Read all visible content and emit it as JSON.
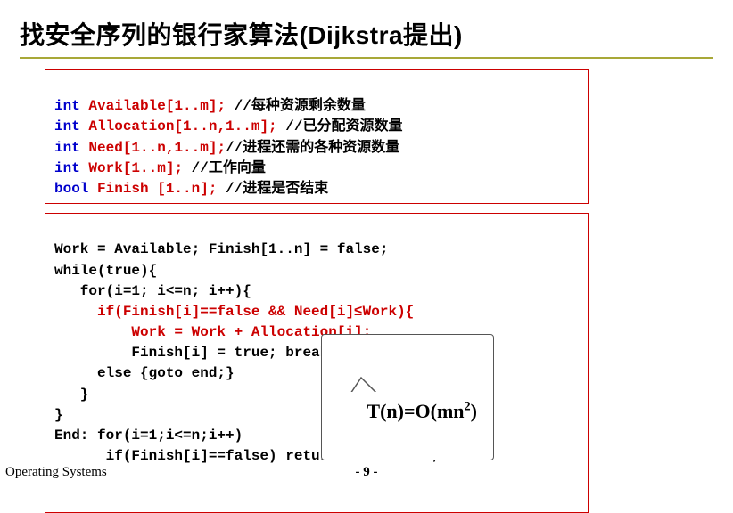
{
  "title": "找安全序列的银行家算法(Dijkstra提出)",
  "box1": {
    "l1": {
      "kw": "int",
      "arr": "Available[1..m];",
      "cmt": " //每种资源剩余数量"
    },
    "l2": {
      "kw": "int",
      "arr": "Allocation[1..n,1..m];",
      "cmt": " //已分配资源数量"
    },
    "l3": {
      "kw": "int",
      "arr": "Need[1..n,1..m];",
      "cmt": "//进程还需的各种资源数量"
    },
    "l4": {
      "kw": "int",
      "arr": "Work[1..m];",
      "cmt": " //工作向量"
    },
    "l5": {
      "kw": "bool",
      "arr": "Finish [1..n];",
      "cmt": " //进程是否结束"
    }
  },
  "box2": {
    "l1": "Work = Available; Finish[1..n] = false;",
    "l2": "while(true){",
    "l3": "   for(i=1; i<=n; i++){",
    "l4": "     if(Finish[i]==false && Need[i]≤Work){",
    "l5": "         Work = Work + Allocation[i];",
    "l6": "         Finish[i] = true; break;}",
    "l7": "     else {goto end;}",
    "l8": "   }",
    "l9": "}",
    "l10": "End: for(i=1;i<=n;i++)",
    "l11": "      if(Finish[i]==false) return \"deadlock\";"
  },
  "callout": {
    "prefix": "T(n)=O(mn",
    "exp": "2",
    "suffix": ")"
  },
  "footer": {
    "left": "Operating Systems",
    "page": "- 9 -"
  }
}
